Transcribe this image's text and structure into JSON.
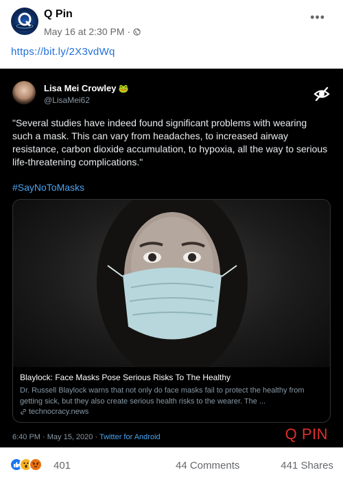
{
  "post": {
    "page_name": "Q Pin",
    "timestamp": "May 16 at 2:30 PM",
    "separator": "·",
    "link": "https://bit.ly/2X3vdWq"
  },
  "tweet": {
    "author_name": "Lisa Mei Crowley",
    "author_emoji": "🐸",
    "handle": "@LisaMei62",
    "body": "\"Several studies have indeed found significant problems with wearing such a mask. This can vary from headaches, to increased airway resistance, carbon dioxide accumulation, to hypoxia, all the way to serious life-threatening complications.\"",
    "hashtag": "#SayNoToMasks",
    "card": {
      "title": "Blaylock: Face Masks Pose Serious Risks To The Healthy",
      "description": "Dr. Russell Blaylock warns that not only do face masks fail to protect the healthy from getting sick, but they also create serious health risks to the wearer. The ...",
      "domain": "technocracy.news"
    },
    "time": "6:40 PM · May 15, 2020 · ",
    "source": "Twitter for Android",
    "watermark": "Q PIN"
  },
  "footer": {
    "reaction_count": "401",
    "comments": "44 Comments",
    "shares": "441 Shares"
  },
  "icons": {
    "more": "more-icon",
    "globe": "globe-icon",
    "hide": "hide-icon",
    "link": "link-icon"
  },
  "colors": {
    "link_blue": "#216fdb",
    "tweet_bg": "#000000",
    "hashtag": "#4aa3f0",
    "watermark": "#e0302a",
    "meta_gray": "#65676b"
  }
}
